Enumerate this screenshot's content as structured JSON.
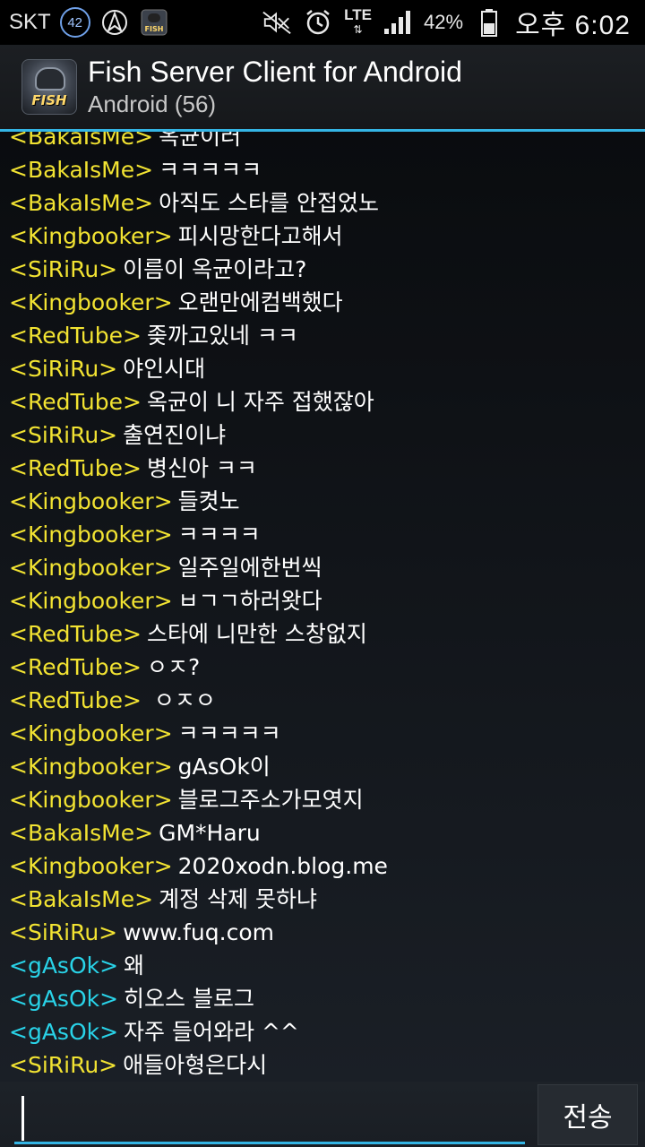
{
  "status_bar": {
    "carrier": "SKT",
    "notification_count": "42",
    "network_type": "LTE",
    "battery_percent": "42%",
    "time": "오후 6:02",
    "icons": [
      "starfleet-icon",
      "fish-app-icon",
      "mute-icon",
      "alarm-icon",
      "signal-icon",
      "battery-icon"
    ]
  },
  "app_bar": {
    "title": "Fish Server Client for Android",
    "subtitle": "Android (56)",
    "logo_text": "FISH"
  },
  "colors": {
    "nick_yellow": "#f2e332",
    "nick_cyan": "#29d3e8",
    "accent": "#34b5e5"
  },
  "chat": {
    "messages": [
      {
        "nick": "<BakaIsMe>",
        "text": "옥균이러",
        "color": "yellow"
      },
      {
        "nick": "<BakaIsMe>",
        "text": "ㅋㅋㅋㅋㅋ",
        "color": "yellow"
      },
      {
        "nick": "<BakaIsMe>",
        "text": "아직도 스타를 안접었노",
        "color": "yellow"
      },
      {
        "nick": "<Kingbooker>",
        "text": "피시망한다고해서",
        "color": "yellow"
      },
      {
        "nick": "<SiRiRu>",
        "text": "이름이 옥균이라고?",
        "color": "yellow"
      },
      {
        "nick": "<Kingbooker>",
        "text": "오랜만에컴백했다",
        "color": "yellow"
      },
      {
        "nick": "<RedTube>",
        "text": "좆까고있네 ㅋㅋ",
        "color": "yellow"
      },
      {
        "nick": "<SiRiRu>",
        "text": "야인시대",
        "color": "yellow"
      },
      {
        "nick": "<RedTube>",
        "text": "옥균이 니 자주 접했잖아",
        "color": "yellow"
      },
      {
        "nick": "<SiRiRu>",
        "text": "출연진이냐",
        "color": "yellow"
      },
      {
        "nick": "<RedTube>",
        "text": "병신아 ㅋㅋ",
        "color": "yellow"
      },
      {
        "nick": "<Kingbooker>",
        "text": "들켯노",
        "color": "yellow"
      },
      {
        "nick": "<Kingbooker>",
        "text": "ㅋㅋㅋㅋ",
        "color": "yellow"
      },
      {
        "nick": "<Kingbooker>",
        "text": "일주일에한번씩",
        "color": "yellow"
      },
      {
        "nick": "<Kingbooker>",
        "text": "ㅂㄱㄱ하러왓다",
        "color": "yellow"
      },
      {
        "nick": "<RedTube>",
        "text": "스타에 니만한 스창없지",
        "color": "yellow"
      },
      {
        "nick": "<RedTube>",
        "text": "ㅇㅈ?",
        "color": "yellow"
      },
      {
        "nick": "<RedTube>",
        "text": " ㅇㅈㅇ",
        "color": "yellow"
      },
      {
        "nick": "<Kingbooker>",
        "text": "ㅋㅋㅋㅋㅋ",
        "color": "yellow"
      },
      {
        "nick": "<Kingbooker>",
        "text": "gAsOk이",
        "color": "yellow"
      },
      {
        "nick": "<Kingbooker>",
        "text": "블로그주소가모엿지",
        "color": "yellow"
      },
      {
        "nick": "<BakaIsMe>",
        "text": "GM*Haru",
        "color": "yellow"
      },
      {
        "nick": "<Kingbooker>",
        "text": "2020xodn.blog.me",
        "color": "yellow"
      },
      {
        "nick": "<BakaIsMe>",
        "text": "계정 삭제 못하냐",
        "color": "yellow"
      },
      {
        "nick": "<SiRiRu>",
        "text": "www.fuq.com",
        "color": "yellow"
      },
      {
        "nick": "<gAsOk>",
        "text": "왜",
        "color": "cyan"
      },
      {
        "nick": "<gAsOk>",
        "text": "히오스 블로그",
        "color": "cyan"
      },
      {
        "nick": "<gAsOk>",
        "text": "자주 들어와라 ^^",
        "color": "cyan"
      },
      {
        "nick": "<SiRiRu>",
        "text": "애들아형은다시",
        "color": "yellow"
      }
    ]
  },
  "input": {
    "value": "",
    "send_label": "전송"
  }
}
